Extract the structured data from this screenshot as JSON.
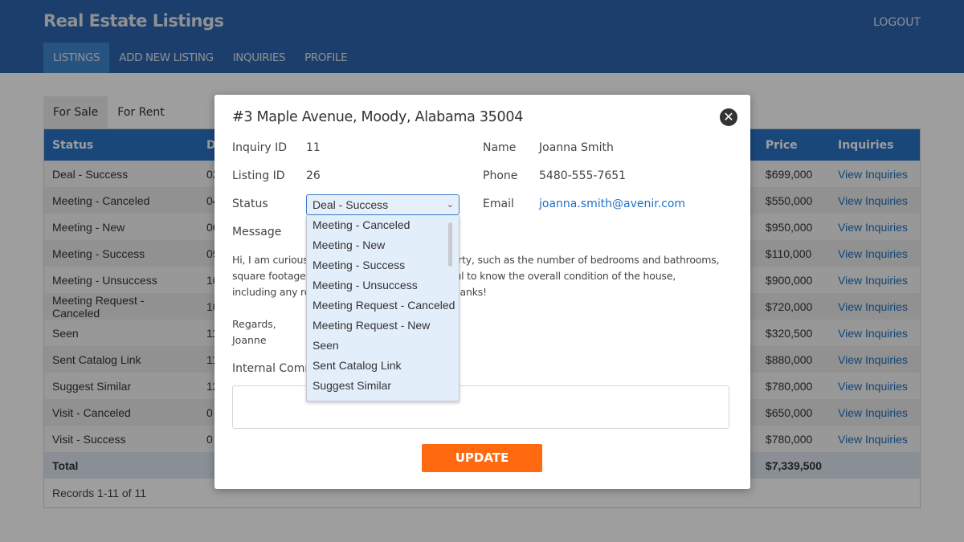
{
  "header": {
    "app_title": "Real Estate Listings",
    "logout_label": "LOGOUT",
    "nav": [
      {
        "label": "LISTINGS",
        "active": true
      },
      {
        "label": "ADD NEW LISTING",
        "active": false
      },
      {
        "label": "INQUIRIES",
        "active": false
      },
      {
        "label": "PROFILE",
        "active": false
      }
    ]
  },
  "tabs": [
    {
      "label": "For Sale",
      "active": true
    },
    {
      "label": "For Rent",
      "active": false
    }
  ],
  "table": {
    "columns": [
      "Status",
      "D",
      "Price",
      "Inquiries"
    ],
    "rows": [
      {
        "status": "Deal - Success",
        "date": "02",
        "price": "$699,000",
        "link": "View Inquiries"
      },
      {
        "status": "Meeting - Canceled",
        "date": "04",
        "price": "$550,000",
        "link": "View Inquiries"
      },
      {
        "status": "Meeting - New",
        "date": "06",
        "price": "$950,000",
        "link": "View Inquiries"
      },
      {
        "status": "Meeting - Success",
        "date": "09",
        "price": "$110,000",
        "link": "View Inquiries"
      },
      {
        "status": "Meeting - Unsuccess",
        "date": "10",
        "price": "$900,000",
        "link": "View Inquiries"
      },
      {
        "status": "Meeting Request - Canceled",
        "date": "10",
        "price": "$720,000",
        "link": "View Inquiries"
      },
      {
        "status": "Seen",
        "date": "11",
        "price": "$320,500",
        "link": "View Inquiries"
      },
      {
        "status": "Sent Catalog Link",
        "date": "11",
        "price": "$880,000",
        "link": "View Inquiries"
      },
      {
        "status": "Suggest Similar",
        "date": "12",
        "price": "$780,000",
        "link": "View Inquiries"
      },
      {
        "status": "Visit - Canceled",
        "date": "0",
        "price": "$650,000",
        "link": "View Inquiries"
      },
      {
        "status": "Visit - Success",
        "date": "0",
        "price": "$780,000",
        "link": "View Inquiries"
      }
    ],
    "total_label": "Total",
    "total_price": "$7,339,500",
    "records": "Records 1-11 of 11"
  },
  "modal": {
    "title": "#3 Maple Avenue, Moody, Alabama 35004",
    "close_icon": "close-circle-icon",
    "inquiry_id_label": "Inquiry ID",
    "inquiry_id": "11",
    "listing_id_label": "Listing ID",
    "listing_id": "26",
    "status_label": "Status",
    "status_value": "Deal - Success",
    "name_label": "Name",
    "name": "Joanna Smith",
    "phone_label": "Phone",
    "phone": "5480-555-7651",
    "email_label": "Email",
    "email": "joanna.smith@avenir.com",
    "message_label": "Message",
    "message": "Hi, I am curious about the details of this property, such as the number of bedrooms and bathrooms, square footage, and lot size. It would be helpful to know the overall condition of the house, including any recent renovations or repairs. Thanks!",
    "signoff_1": "Regards,",
    "signoff_2": "Joanne",
    "comment_label": "Internal Comment",
    "comment_value": "",
    "update_label": "UPDATE",
    "status_options": [
      "Meeting - Canceled",
      "Meeting - New",
      "Meeting - Success",
      "Meeting - Unsuccess",
      "Meeting Request - Canceled",
      "Meeting Request - New",
      "Seen",
      "Sent Catalog Link",
      "Suggest Similar"
    ]
  },
  "colors": {
    "header_bg": "#2c64b0",
    "nav_active": "#3f86d0",
    "table_header": "#2a73c6",
    "link": "#1f6fc0",
    "update_button": "#ff6a10"
  }
}
